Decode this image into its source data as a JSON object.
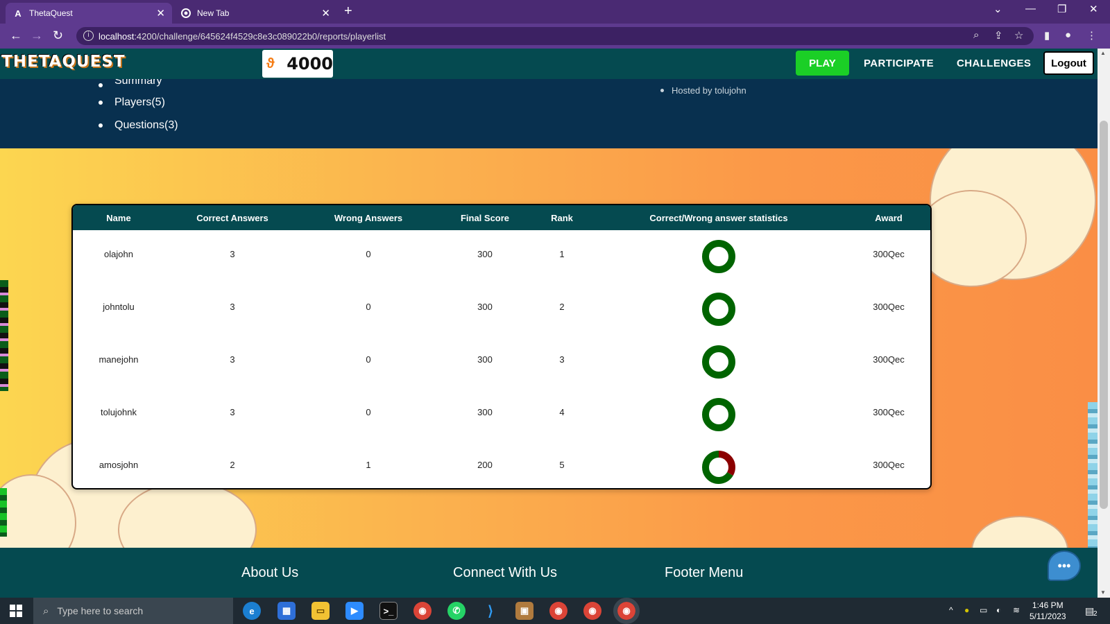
{
  "browser": {
    "tabs": [
      {
        "label": "ThetaQuest",
        "favicon": "angular-icon",
        "active": true
      },
      {
        "label": "New Tab",
        "favicon": "chrome-icon",
        "active": false
      }
    ],
    "new_tab": "+",
    "url_host": "localhost",
    "url_rest": ":4200/challenge/645624f4529c8e3c089022b0/reports/playerlist"
  },
  "header": {
    "logo": "THETAQUEST",
    "coin_balance": "4000",
    "nav": {
      "play": "PLAY",
      "participate": "PARTICIPATE",
      "challenges": "CHALLENGES",
      "logout": "Logout"
    }
  },
  "subnav": {
    "items": [
      "Summary",
      "Players(5)",
      "Questions(3)"
    ],
    "hosted": "Hosted by tolujohn"
  },
  "table": {
    "headers": [
      "Name",
      "Correct Answers",
      "Wrong Answers",
      "Final Score",
      "Rank",
      "Correct/Wrong answer statistics",
      "Award"
    ],
    "rows": [
      {
        "name": "olajohn",
        "correct": "3",
        "wrong": "0",
        "score": "300",
        "rank": "1",
        "award": "300Qec"
      },
      {
        "name": "johntolu",
        "correct": "3",
        "wrong": "0",
        "score": "300",
        "rank": "2",
        "award": "300Qec"
      },
      {
        "name": "manejohn",
        "correct": "3",
        "wrong": "0",
        "score": "300",
        "rank": "3",
        "award": "300Qec"
      },
      {
        "name": "tolujohnk",
        "correct": "3",
        "wrong": "0",
        "score": "300",
        "rank": "4",
        "award": "300Qec"
      },
      {
        "name": "amosjohn",
        "correct": "2",
        "wrong": "1",
        "score": "200",
        "rank": "5",
        "award": "300Qec"
      }
    ],
    "colors": {
      "correct": "#006400",
      "wrong": "#8b0000"
    }
  },
  "footer": {
    "about": "About Us",
    "connect": "Connect With Us",
    "menu": "Footer Menu"
  },
  "taskbar": {
    "search_placeholder": "Type here to search",
    "time": "1:46 PM",
    "date": "5/11/2023",
    "notifications": "2"
  }
}
